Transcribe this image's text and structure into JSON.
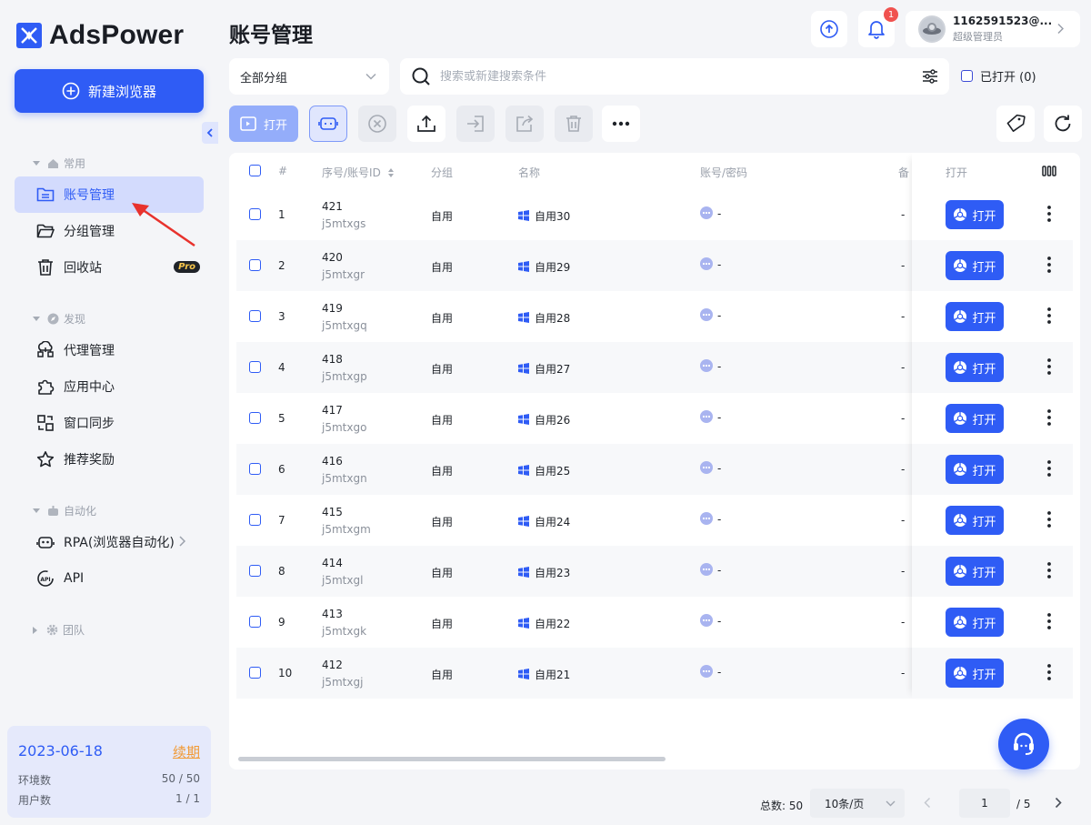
{
  "app": {
    "name": "AdsPower"
  },
  "sidebar": {
    "new_button": "新建浏览器",
    "sections": [
      {
        "title": "常用"
      },
      {
        "title": "发现"
      },
      {
        "title": "自动化"
      },
      {
        "title": "团队"
      }
    ],
    "items": [
      {
        "label": "账号管理",
        "active": true
      },
      {
        "label": "分组管理"
      },
      {
        "label": "回收站",
        "badge": "Pro"
      },
      {
        "label": "代理管理"
      },
      {
        "label": "应用中心"
      },
      {
        "label": "窗口同步"
      },
      {
        "label": "推荐奖励"
      },
      {
        "label": "RPA(浏览器自动化)"
      },
      {
        "label": "API"
      }
    ],
    "plan": {
      "expiry": "2023-06-18",
      "renew": "续期",
      "env_label": "环境数",
      "env_value": "50 / 50",
      "user_label": "用户数",
      "user_value": "1 / 1"
    }
  },
  "header": {
    "title": "账号管理",
    "notification_count": "1",
    "user": {
      "name": "1162591523@...",
      "role": "超级管理员"
    }
  },
  "filters": {
    "group_select": "全部分组",
    "search_placeholder": "搜索或新建搜索条件",
    "opened_label": "已打开 (0)"
  },
  "toolbar": {
    "open_label": "打开"
  },
  "table": {
    "columns": {
      "index": "#",
      "serial": "序号/账号ID",
      "group": "分组",
      "name": "名称",
      "account": "账号/密码",
      "remark": "备",
      "open": "打开"
    },
    "open_button": "打开",
    "rows": [
      {
        "idx": "1",
        "serial": "421",
        "id": "j5mtxgs",
        "group": "自用",
        "name": "自用30",
        "account": "-",
        "remark": "-"
      },
      {
        "idx": "2",
        "serial": "420",
        "id": "j5mtxgr",
        "group": "自用",
        "name": "自用29",
        "account": "-",
        "remark": "-"
      },
      {
        "idx": "3",
        "serial": "419",
        "id": "j5mtxgq",
        "group": "自用",
        "name": "自用28",
        "account": "-",
        "remark": "-"
      },
      {
        "idx": "4",
        "serial": "418",
        "id": "j5mtxgp",
        "group": "自用",
        "name": "自用27",
        "account": "-",
        "remark": "-"
      },
      {
        "idx": "5",
        "serial": "417",
        "id": "j5mtxgo",
        "group": "自用",
        "name": "自用26",
        "account": "-",
        "remark": "-"
      },
      {
        "idx": "6",
        "serial": "416",
        "id": "j5mtxgn",
        "group": "自用",
        "name": "自用25",
        "account": "-",
        "remark": "-"
      },
      {
        "idx": "7",
        "serial": "415",
        "id": "j5mtxgm",
        "group": "自用",
        "name": "自用24",
        "account": "-",
        "remark": "-"
      },
      {
        "idx": "8",
        "serial": "414",
        "id": "j5mtxgl",
        "group": "自用",
        "name": "自用23",
        "account": "-",
        "remark": "-"
      },
      {
        "idx": "9",
        "serial": "413",
        "id": "j5mtxgk",
        "group": "自用",
        "name": "自用22",
        "account": "-",
        "remark": "-"
      },
      {
        "idx": "10",
        "serial": "412",
        "id": "j5mtxgj",
        "group": "自用",
        "name": "自用21",
        "account": "-",
        "remark": "-"
      }
    ]
  },
  "pagination": {
    "total": "总数: 50",
    "page_size": "10条/页",
    "current": "1",
    "of_pages": "/ 5"
  },
  "colors": {
    "primary": "#2f5cf5",
    "active_bg": "#d3dbfd",
    "badge_red": "#f0524f",
    "renew": "#f19a36"
  }
}
